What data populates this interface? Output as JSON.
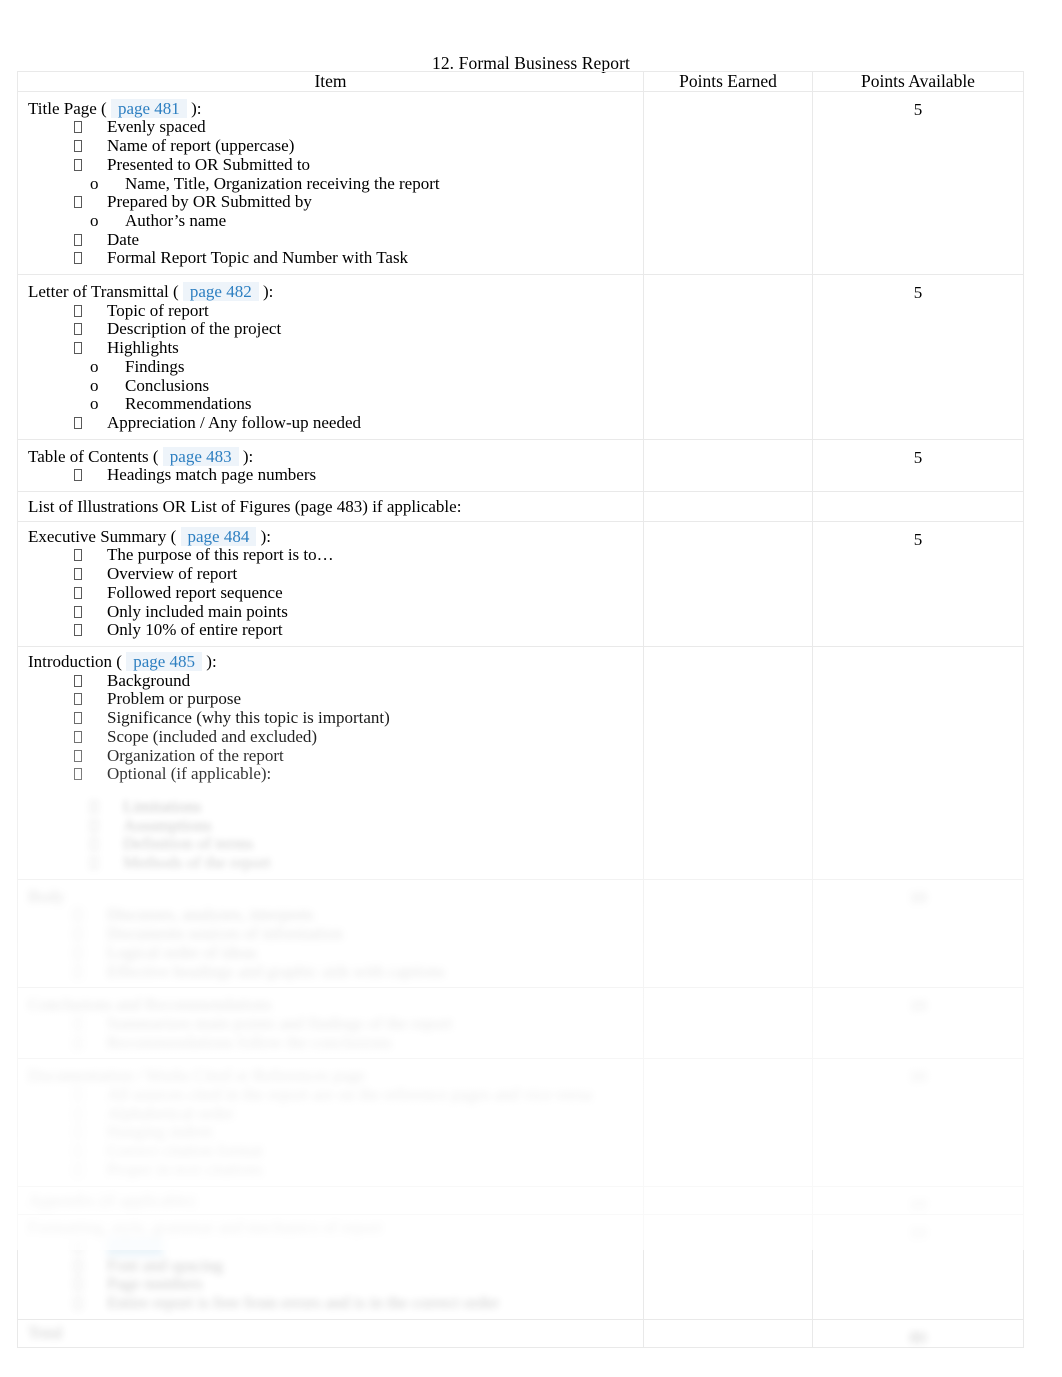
{
  "document": {
    "title": "12. Formal Business Report"
  },
  "table": {
    "headers": {
      "item": "Item",
      "points_earned": "Points Earned",
      "points_available": "Points Available"
    },
    "rows": [
      {
        "section": "Title Page (",
        "link": "page 481",
        "section_tail": "):",
        "points_earned": "",
        "points_available": "5",
        "bullets": [
          {
            "level": 1,
            "text": "Evenly spaced"
          },
          {
            "level": 1,
            "text": "Name of report (uppercase)"
          },
          {
            "level": 1,
            "text": "Presented to OR Submitted to"
          },
          {
            "level": 2,
            "text": "Name, Title, Organization receiving the report"
          },
          {
            "level": 1,
            "text": "Prepared by OR Submitted by"
          },
          {
            "level": 2,
            "text": "Author’s name"
          },
          {
            "level": 1,
            "text": "Date"
          },
          {
            "level": 1,
            "text": "Formal Report Topic and Number with Task"
          }
        ]
      },
      {
        "section": "Letter of Transmittal (",
        "link": "page 482",
        "section_tail": "):",
        "points_earned": "",
        "points_available": "5",
        "bullets": [
          {
            "level": 1,
            "text": "Topic of report"
          },
          {
            "level": 1,
            "text": "Description of the project"
          },
          {
            "level": 1,
            "text": "Highlights"
          },
          {
            "level": 2,
            "text": "Findings"
          },
          {
            "level": 2,
            "text": "Conclusions"
          },
          {
            "level": 2,
            "text": "Recommendations"
          },
          {
            "level": 1,
            "text": "Appreciation / Any follow-up needed"
          }
        ]
      },
      {
        "section": "Table of Contents (",
        "link": "page 483",
        "section_tail": "):",
        "points_earned": "",
        "points_available": "5",
        "bullets": [
          {
            "level": 1,
            "text": "Headings match page numbers"
          }
        ]
      },
      {
        "section": "List of Illustrations OR List of Figures (page 483) if applicable:",
        "link": "",
        "section_tail": "",
        "points_earned": "",
        "points_available": "",
        "bullets": []
      },
      {
        "section": "Executive Summary (",
        "link": "page 484",
        "section_tail": "):",
        "points_earned": "",
        "points_available": "5",
        "bullets": [
          {
            "level": 1,
            "text": "The purpose of this report is to…"
          },
          {
            "level": 1,
            "text": "Overview of report"
          },
          {
            "level": 1,
            "text": "Followed report sequence"
          },
          {
            "level": 1,
            "text": "Only included main points"
          },
          {
            "level": 1,
            "text": "Only 10% of entire report"
          }
        ]
      },
      {
        "section": "Introduction (",
        "link": "page 485",
        "section_tail": "):",
        "points_earned": "",
        "points_available": "",
        "bullets": [
          {
            "level": 1,
            "text": "Background"
          },
          {
            "level": 1,
            "text": "Problem or purpose"
          },
          {
            "level": 1,
            "text": "Significance (why this topic is important)"
          },
          {
            "level": 1,
            "text": "Scope (included and excluded)"
          },
          {
            "level": 1,
            "text": "Organization of the report"
          },
          {
            "level": 1,
            "text": "Optional (if applicable):"
          },
          {
            "level": 3,
            "obscured": true,
            "text": "Limitations"
          },
          {
            "level": 3,
            "obscured": true,
            "text": "Assumptions"
          },
          {
            "level": 3,
            "obscured": true,
            "text": "Definition of terms"
          },
          {
            "level": 3,
            "obscured": true,
            "text": "Methods of the report"
          }
        ]
      }
    ],
    "obscured_rows": [
      {
        "section": "Body",
        "points_available": "10",
        "obscured": true,
        "bullets": [
          {
            "level": 1,
            "text": "Discusses, analyzes, interprets"
          },
          {
            "level": 1,
            "text": "Documents sources of information"
          },
          {
            "level": 1,
            "text": "Logical order of ideas"
          },
          {
            "level": 1,
            "text": "Effective headings and graphic aids with captions"
          }
        ]
      },
      {
        "section": "Conclusions and Recommendations",
        "points_available": "10",
        "obscured": true,
        "bullets": [
          {
            "level": 1,
            "text": "Summarizes main points and findings of the report"
          },
          {
            "level": 1,
            "text": "Recommendations follow the conclusions"
          }
        ]
      },
      {
        "section": "Documentation / Works Cited or References page",
        "points_available": "10",
        "obscured": true,
        "bullets": [
          {
            "level": 1,
            "text": "All sources cited in the report are on the reference pages and vice versa"
          },
          {
            "level": 1,
            "text": "Alphabetical order"
          },
          {
            "level": 1,
            "text": "Hanging indent"
          },
          {
            "level": 1,
            "text": "Correct citation format"
          },
          {
            "level": 1,
            "text": "Proper in-text citations"
          }
        ]
      },
      {
        "section": "Appendix (if applicable)",
        "points_available": "10",
        "obscured": true,
        "bullets": []
      },
      {
        "section": "Formatting, style, grammar and mechanics of report",
        "points_available": "10",
        "obscured": true,
        "bullets": [
          {
            "level": 1,
            "text": "Margins"
          },
          {
            "level": 1,
            "text": "Font and spacing"
          },
          {
            "level": 1,
            "text": "Page numbers"
          },
          {
            "level": 1,
            "text": "Entire report is free from errors and is in the correct order"
          }
        ]
      },
      {
        "section": "Total",
        "points_available": "80",
        "obscured": true,
        "bullets": []
      }
    ]
  },
  "colors": {
    "link": "#2d7fc1",
    "link_highlight": "#eef4fa",
    "border": "#e9e9e9",
    "text": "#000000",
    "blue_highlight": "#a8cfe8"
  }
}
